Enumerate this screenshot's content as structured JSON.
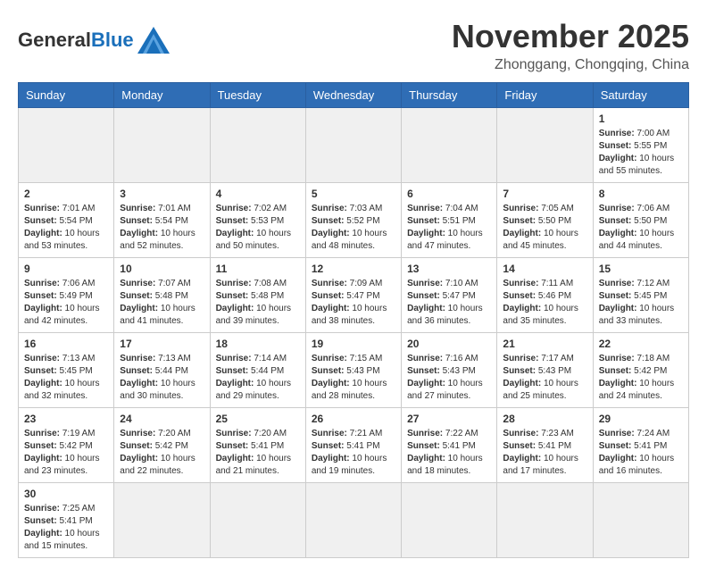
{
  "header": {
    "logo_general": "General",
    "logo_blue": "Blue",
    "title": "November 2025",
    "subtitle": "Zhonggang, Chongqing, China"
  },
  "weekdays": [
    "Sunday",
    "Monday",
    "Tuesday",
    "Wednesday",
    "Thursday",
    "Friday",
    "Saturday"
  ],
  "weeks": [
    [
      {
        "day": "",
        "empty": true
      },
      {
        "day": "",
        "empty": true
      },
      {
        "day": "",
        "empty": true
      },
      {
        "day": "",
        "empty": true
      },
      {
        "day": "",
        "empty": true
      },
      {
        "day": "",
        "empty": true
      },
      {
        "day": "1",
        "sunrise": "7:00 AM",
        "sunset": "5:55 PM",
        "daylight": "10 hours and 55 minutes."
      }
    ],
    [
      {
        "day": "2",
        "sunrise": "7:01 AM",
        "sunset": "5:54 PM",
        "daylight": "10 hours and 53 minutes."
      },
      {
        "day": "3",
        "sunrise": "7:01 AM",
        "sunset": "5:54 PM",
        "daylight": "10 hours and 52 minutes."
      },
      {
        "day": "4",
        "sunrise": "7:02 AM",
        "sunset": "5:53 PM",
        "daylight": "10 hours and 50 minutes."
      },
      {
        "day": "5",
        "sunrise": "7:03 AM",
        "sunset": "5:52 PM",
        "daylight": "10 hours and 48 minutes."
      },
      {
        "day": "6",
        "sunrise": "7:04 AM",
        "sunset": "5:51 PM",
        "daylight": "10 hours and 47 minutes."
      },
      {
        "day": "7",
        "sunrise": "7:05 AM",
        "sunset": "5:50 PM",
        "daylight": "10 hours and 45 minutes."
      },
      {
        "day": "8",
        "sunrise": "7:06 AM",
        "sunset": "5:50 PM",
        "daylight": "10 hours and 44 minutes."
      }
    ],
    [
      {
        "day": "9",
        "sunrise": "7:06 AM",
        "sunset": "5:49 PM",
        "daylight": "10 hours and 42 minutes."
      },
      {
        "day": "10",
        "sunrise": "7:07 AM",
        "sunset": "5:48 PM",
        "daylight": "10 hours and 41 minutes."
      },
      {
        "day": "11",
        "sunrise": "7:08 AM",
        "sunset": "5:48 PM",
        "daylight": "10 hours and 39 minutes."
      },
      {
        "day": "12",
        "sunrise": "7:09 AM",
        "sunset": "5:47 PM",
        "daylight": "10 hours and 38 minutes."
      },
      {
        "day": "13",
        "sunrise": "7:10 AM",
        "sunset": "5:47 PM",
        "daylight": "10 hours and 36 minutes."
      },
      {
        "day": "14",
        "sunrise": "7:11 AM",
        "sunset": "5:46 PM",
        "daylight": "10 hours and 35 minutes."
      },
      {
        "day": "15",
        "sunrise": "7:12 AM",
        "sunset": "5:45 PM",
        "daylight": "10 hours and 33 minutes."
      }
    ],
    [
      {
        "day": "16",
        "sunrise": "7:13 AM",
        "sunset": "5:45 PM",
        "daylight": "10 hours and 32 minutes."
      },
      {
        "day": "17",
        "sunrise": "7:13 AM",
        "sunset": "5:44 PM",
        "daylight": "10 hours and 30 minutes."
      },
      {
        "day": "18",
        "sunrise": "7:14 AM",
        "sunset": "5:44 PM",
        "daylight": "10 hours and 29 minutes."
      },
      {
        "day": "19",
        "sunrise": "7:15 AM",
        "sunset": "5:43 PM",
        "daylight": "10 hours and 28 minutes."
      },
      {
        "day": "20",
        "sunrise": "7:16 AM",
        "sunset": "5:43 PM",
        "daylight": "10 hours and 27 minutes."
      },
      {
        "day": "21",
        "sunrise": "7:17 AM",
        "sunset": "5:43 PM",
        "daylight": "10 hours and 25 minutes."
      },
      {
        "day": "22",
        "sunrise": "7:18 AM",
        "sunset": "5:42 PM",
        "daylight": "10 hours and 24 minutes."
      }
    ],
    [
      {
        "day": "23",
        "sunrise": "7:19 AM",
        "sunset": "5:42 PM",
        "daylight": "10 hours and 23 minutes."
      },
      {
        "day": "24",
        "sunrise": "7:20 AM",
        "sunset": "5:42 PM",
        "daylight": "10 hours and 22 minutes."
      },
      {
        "day": "25",
        "sunrise": "7:20 AM",
        "sunset": "5:41 PM",
        "daylight": "10 hours and 21 minutes."
      },
      {
        "day": "26",
        "sunrise": "7:21 AM",
        "sunset": "5:41 PM",
        "daylight": "10 hours and 19 minutes."
      },
      {
        "day": "27",
        "sunrise": "7:22 AM",
        "sunset": "5:41 PM",
        "daylight": "10 hours and 18 minutes."
      },
      {
        "day": "28",
        "sunrise": "7:23 AM",
        "sunset": "5:41 PM",
        "daylight": "10 hours and 17 minutes."
      },
      {
        "day": "29",
        "sunrise": "7:24 AM",
        "sunset": "5:41 PM",
        "daylight": "10 hours and 16 minutes."
      }
    ],
    [
      {
        "day": "30",
        "sunrise": "7:25 AM",
        "sunset": "5:41 PM",
        "daylight": "10 hours and 15 minutes."
      },
      {
        "day": "",
        "empty": true
      },
      {
        "day": "",
        "empty": true
      },
      {
        "day": "",
        "empty": true
      },
      {
        "day": "",
        "empty": true
      },
      {
        "day": "",
        "empty": true
      },
      {
        "day": "",
        "empty": true
      }
    ]
  ],
  "labels": {
    "sunrise": "Sunrise:",
    "sunset": "Sunset:",
    "daylight": "Daylight:"
  }
}
